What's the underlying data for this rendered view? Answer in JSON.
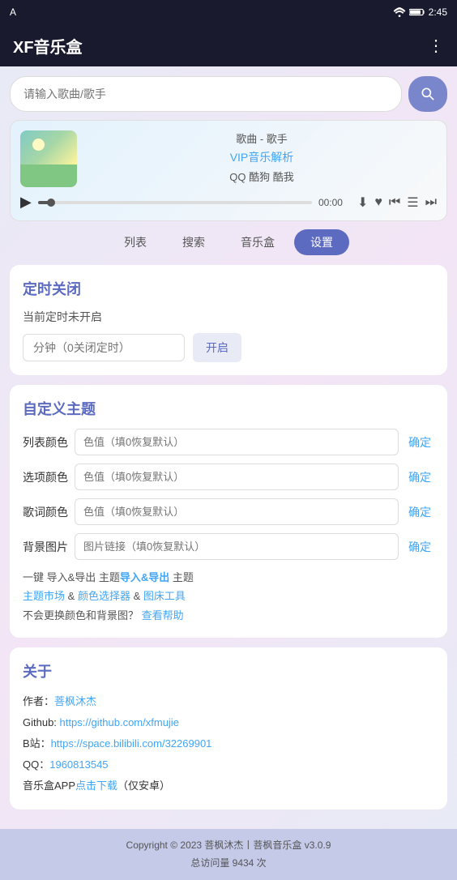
{
  "statusBar": {
    "appIcon": "A",
    "time": "2:45",
    "wifiIcon": "wifi",
    "batteryIcon": "battery"
  },
  "header": {
    "title": "XF音乐盒",
    "menuIcon": "⋮"
  },
  "search": {
    "placeholder": "请输入歌曲/歌手",
    "searchIconLabel": "🔍"
  },
  "player": {
    "songLabel": "歌曲 - 歌手",
    "vipLink": "VIP音乐解析",
    "platforms": "QQ 酷狗 酷我",
    "time": "00:00",
    "progressPercent": 5
  },
  "tabs": [
    {
      "id": "list",
      "label": "列表",
      "active": false
    },
    {
      "id": "search",
      "label": "搜索",
      "active": false
    },
    {
      "id": "musicbox",
      "label": "音乐盒",
      "active": false
    },
    {
      "id": "settings",
      "label": "设置",
      "active": true
    }
  ],
  "timer": {
    "title": "定时关闭",
    "subtitle": "当前定时未开启",
    "inputPlaceholder": "分钟（0关闭定时）",
    "buttonLabel": "开启"
  },
  "theme": {
    "title": "自定义主题",
    "rows": [
      {
        "label": "列表颜色",
        "placeholder": "色值（填0恢复默认）",
        "confirmLabel": "确定"
      },
      {
        "label": "选项颜色",
        "placeholder": "色值（填0恢复默认）",
        "confirmLabel": "确定"
      },
      {
        "label": "歌词颜色",
        "placeholder": "色值（填0恢复默认）",
        "confirmLabel": "确定"
      },
      {
        "label": "背景图片",
        "placeholder": "图片链接（填0恢复默认）",
        "confirmLabel": "确定"
      }
    ],
    "actions": {
      "exportImportText": "一键 导入&导出 主题",
      "marketText": "主题市场",
      "ampText1": " & ",
      "colorPickerText": "颜色选择器",
      "ampText2": " & ",
      "bedToolText": "图床工具",
      "helpLine": "不会更换颜色和背景图？",
      "helpLink": "查看帮助"
    }
  },
  "about": {
    "title": "关于",
    "author": "作者：",
    "authorLink": "菩枫沐杰",
    "githubLabel": "Github: ",
    "githubLink": "https://github.com/xfmujie",
    "bstationLabel": "B站：",
    "bstationLink": "https://space.bilibili.com/32269901",
    "qqLabel": "QQ：",
    "qqLink": "1960813545",
    "appLine": "音乐盒APP",
    "appLink": "点击下载",
    "appSuffix": "（仅安卓）"
  },
  "footer": {
    "copyright": "Copyright © 2023 菩枫沐杰丨菩枫音乐盒 v3.0.9",
    "visits": "总访问量 9434 次"
  }
}
